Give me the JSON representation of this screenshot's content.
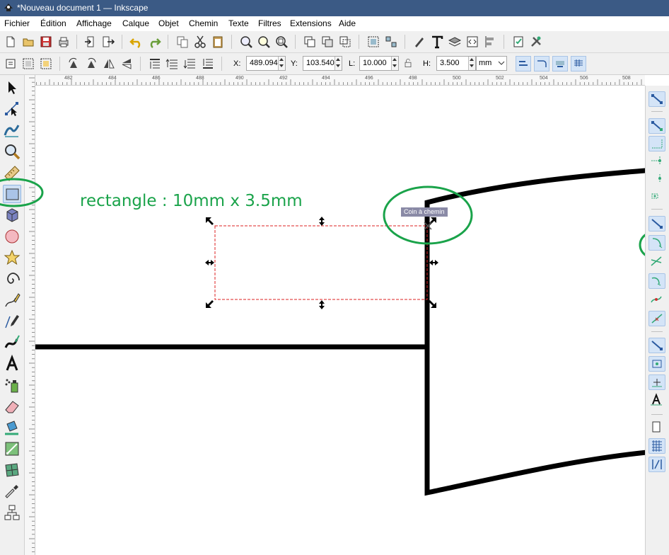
{
  "window": {
    "title": "*Nouveau document 1 — Inkscape"
  },
  "menu": [
    "Fichier",
    "Édition",
    "Affichage",
    "Calque",
    "Objet",
    "Chemin",
    "Texte",
    "Filtres",
    "Extensions",
    "Aide"
  ],
  "controls": {
    "x_label": "X:",
    "x_value": "489.094",
    "y_label": "Y:",
    "y_value": "103.540",
    "w_label": "L:",
    "w_value": "10.000",
    "h_label": "H:",
    "h_value": "3.500",
    "unit": "mm"
  },
  "ruler": {
    "h_labels": [
      "482",
      "484",
      "486",
      "488",
      "490",
      "492",
      "494",
      "496",
      "498",
      "500",
      "502",
      "504",
      "506",
      "508"
    ]
  },
  "annotation": {
    "text": "rectangle : 10mm x 3.5mm"
  },
  "tooltip": {
    "text": "Coin à chemin"
  },
  "colors": {
    "titlebar": "#3b5a85",
    "annotation": "#1aa34a",
    "selection_dash": "#d22",
    "toolbar_bg": "#f0f0f0",
    "active_tool": "#cfe0f4"
  },
  "icons": {
    "tools": [
      "selector-arrow-icon",
      "node-editor-icon",
      "tweak-icon",
      "zoom-icon",
      "measure-icon",
      "rectangle-icon",
      "box3d-icon",
      "ellipse-icon",
      "star-icon",
      "spiral-icon",
      "pencil-icon",
      "pen-icon",
      "calligraphy-icon",
      "text-icon",
      "spray-icon",
      "eraser-icon",
      "paint-bucket-icon",
      "gradient-icon",
      "mesh-icon",
      "dropper-icon",
      "connector-icon"
    ],
    "active_tool": "rectangle-icon"
  }
}
